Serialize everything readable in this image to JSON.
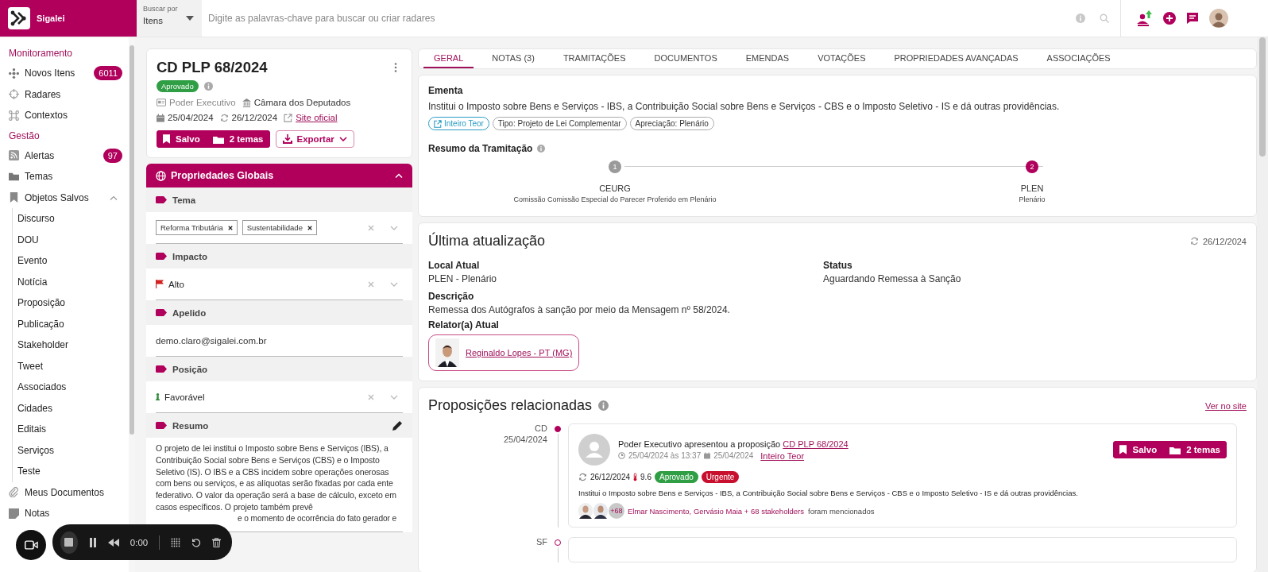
{
  "app": {
    "name": "Sigalei"
  },
  "search": {
    "scope_label": "Buscar por",
    "scope_value": "Itens",
    "placeholder": "Digite as palavras-chave para buscar ou criar radares"
  },
  "sidebar": {
    "sections": [
      {
        "title": "Monitoramento",
        "items": [
          {
            "label": "Novos Itens",
            "badge": "6011"
          },
          {
            "label": "Radares"
          },
          {
            "label": "Contextos"
          }
        ]
      },
      {
        "title": "Gestão",
        "items": [
          {
            "label": "Alertas",
            "badge": "97"
          },
          {
            "label": "Temas"
          },
          {
            "label": "Objetos Salvos",
            "expanded": true,
            "children": [
              {
                "label": "Discurso"
              },
              {
                "label": "DOU"
              },
              {
                "label": "Evento"
              },
              {
                "label": "Notícia"
              },
              {
                "label": "Proposição"
              },
              {
                "label": "Publicação"
              },
              {
                "label": "Stakeholder"
              },
              {
                "label": "Tweet"
              },
              {
                "label": "Associados"
              },
              {
                "label": "Cidades"
              },
              {
                "label": "Editais"
              },
              {
                "label": "Serviços"
              },
              {
                "label": "Teste"
              }
            ]
          },
          {
            "label": "Meus Documentos"
          },
          {
            "label": "Notas"
          }
        ]
      }
    ]
  },
  "record": {
    "title": "CD PLP 68/2024",
    "status": "Aprovado",
    "author": "Poder Executivo",
    "house": "Câmara dos Deputados",
    "presented": "25/04/2024",
    "updated": "26/12/2024",
    "official_link": "Site oficial",
    "saved_button": "Salvo",
    "themes_button": "2 temas",
    "export_button": "Exportar"
  },
  "properties": {
    "title": "Propriedades Globais",
    "expanded": true,
    "fields": [
      {
        "label": "Tema",
        "kind": "tags",
        "tags": [
          "Reforma Tributária",
          "Sustentabilidade"
        ]
      },
      {
        "label": "Impacto",
        "kind": "select",
        "value": "Alto"
      },
      {
        "label": "Apelido",
        "kind": "input",
        "value": "demo.claro@sigalei.com.br"
      },
      {
        "label": "Posição",
        "kind": "select",
        "value": "Favorável"
      },
      {
        "label": "Resumo",
        "kind": "text",
        "value": "O projeto de lei institui o Imposto sobre Bens e Serviços (IBS), a Contribuição Social sobre Bens e Serviços (CBS) e o Imposto Seletivo (IS). O IBS e a CBS incidem sobre operações onerosas com bens ou serviços, e as alíquotas serão fixadas por cada ente federativo. O valor da operação será a base de cálculo, exceto em casos específicos. O projeto também prevê",
        "tail": "e o momento de ocorrência do fato gerador e"
      }
    ]
  },
  "tabs": [
    {
      "label": "GERAL",
      "selected": true
    },
    {
      "label": "NOTAS (3)",
      "selected": false
    },
    {
      "label": "TRAMITAÇÕES",
      "selected": false
    },
    {
      "label": "DOCUMENTOS",
      "selected": false
    },
    {
      "label": "EMENDAS",
      "selected": false
    },
    {
      "label": "VOTAÇÕES",
      "selected": false
    },
    {
      "label": "PROPRIEDADES AVANÇADAS",
      "selected": false
    },
    {
      "label": "ASSOCIAÇÕES",
      "selected": false
    }
  ],
  "ementa": {
    "title": "Ementa",
    "text": "Institui o Imposto sobre Bens e Serviços - IBS, a Contribuição Social sobre Bens e Serviços - CBS e o Imposto Seletivo - IS e dá outras providências.",
    "chips": [
      {
        "label": "Inteiro Teor",
        "kind": "link"
      },
      {
        "label": "Tipo: Projeto de Lei Complementar",
        "kind": "tag"
      },
      {
        "label": "Apreciação: Plenário",
        "kind": "tag"
      }
    ]
  },
  "tramitacao": {
    "title": "Resumo da Tramitação",
    "steps": [
      {
        "number": "1",
        "code": "CEURG",
        "name": "Comissão Comissão Especial do Parecer Proferido em Plenário",
        "current": false
      },
      {
        "number": "2",
        "code": "PLEN",
        "name": "Plenário",
        "current": true
      }
    ]
  },
  "update": {
    "title": "Última atualização",
    "date": "26/12/2024",
    "fields": [
      {
        "label": "Local Atual",
        "value": "PLEN - Plenário"
      },
      {
        "label": "Status",
        "value": "Aguardando Remessa à Sanção"
      },
      {
        "label": "Descrição",
        "value": "Remessa dos Autógrafos à sanção por meio da Mensagem nº 58/2024."
      }
    ],
    "rapporteur_label": "Relator(a) Atual",
    "rapporteur": "Reginaldo Lopes - PT (MG)"
  },
  "related": {
    "title": "Proposições relacionadas",
    "link": "Ver no site",
    "entries": [
      {
        "house": "CD",
        "date": "25/04/2024",
        "active": true,
        "event": "Poder Executivo apresentou a proposição",
        "proposition": "CD PLP 68/2024",
        "created": "25/04/2024 às 13:37",
        "presented": "25/04/2024",
        "document_link": "Inteiro Teor",
        "updated": "26/12/2024",
        "score": "9.6",
        "badges": [
          {
            "label": "Aprovado",
            "color": "#2f9e44"
          },
          {
            "label": "Urgente",
            "color": "#c8102e"
          }
        ],
        "summary": "Institui o Imposto sobre Bens e Serviços - IBS, a Contribuição Social sobre Bens e Serviços - CBS e o Imposto Seletivo - IS e dá outras providências.",
        "more_count": "+68",
        "stakeholders": "Elmar Nascimento, Gervásio Maia + 68 stakeholders",
        "mention_suffix": "foram mencionados",
        "saved_button": "Salvo",
        "themes_button": "2 temas"
      },
      {
        "house": "SF",
        "active": false
      }
    ]
  },
  "recorder": {
    "time": "0:00"
  }
}
